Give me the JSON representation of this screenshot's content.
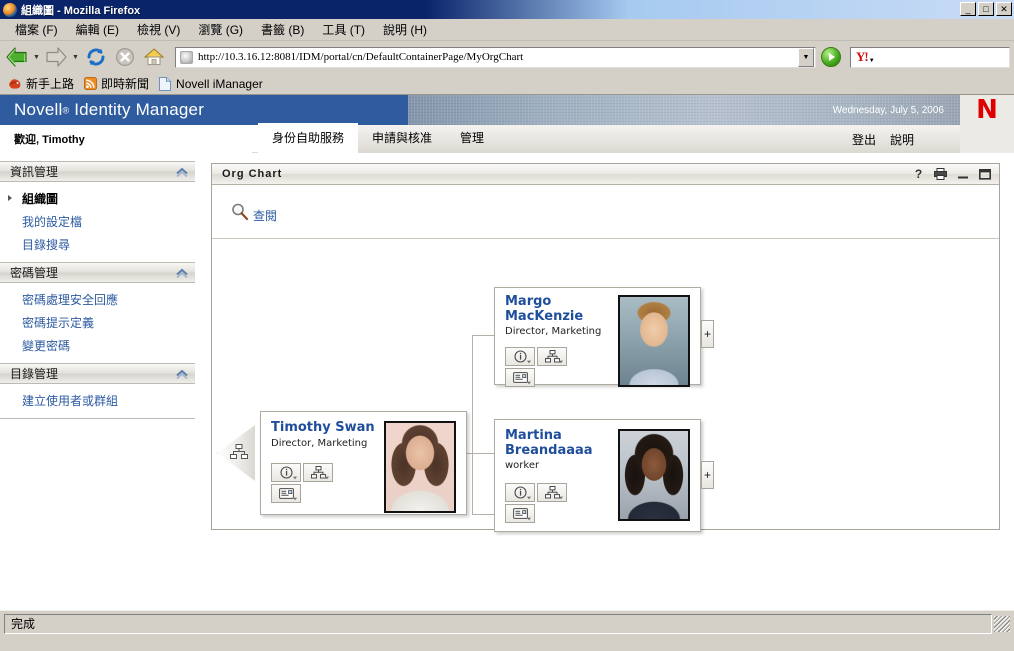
{
  "window": {
    "title": "組織圖 - Mozilla Firefox",
    "controls": {
      "minimize": "_",
      "maximize": "□",
      "close": "✕"
    }
  },
  "menubar": {
    "items": [
      {
        "label": "檔案 (F)"
      },
      {
        "label": "編輯 (E)"
      },
      {
        "label": "檢視 (V)"
      },
      {
        "label": "瀏覽 (G)"
      },
      {
        "label": "書籤 (B)"
      },
      {
        "label": "工具 (T)"
      },
      {
        "label": "說明 (H)"
      }
    ]
  },
  "navbar": {
    "url": "http://10.3.16.12:8081/IDM/portal/cn/DefaultContainerPage/MyOrgChart",
    "search_placeholder": "",
    "search_value": "",
    "yahoo_label": "Y!"
  },
  "bookmarks": {
    "items": [
      {
        "label": "新手上路",
        "icon": "firefox-bookmark-icon"
      },
      {
        "label": "即時新聞",
        "icon": "rss-feed-icon"
      },
      {
        "label": "Novell iManager",
        "icon": "page-icon"
      }
    ]
  },
  "banner": {
    "product": "Novell",
    "registered": "®",
    "product_suffix": "Identity Manager",
    "date": "Wednesday, July 5, 2006",
    "logo_letter": "N",
    "logo_color": "#e00000",
    "brand_blue": "#2f5c9e"
  },
  "tabrow": {
    "welcome": "歡迎, Timothy",
    "tabs": [
      {
        "label": "身份自助服務",
        "active": true
      },
      {
        "label": "申請與核准",
        "active": false
      },
      {
        "label": "管理",
        "active": false
      }
    ],
    "links": [
      {
        "label": "登出"
      },
      {
        "label": "說明"
      }
    ]
  },
  "sidebar": {
    "sections": [
      {
        "title": "資訊管理",
        "items": [
          {
            "label": "組織圖",
            "current": true
          },
          {
            "label": "我的設定檔",
            "current": false
          },
          {
            "label": "目錄搜尋",
            "current": false
          }
        ]
      },
      {
        "title": "密碼管理",
        "items": [
          {
            "label": "密碼處理安全回應",
            "current": false
          },
          {
            "label": "密碼提示定義",
            "current": false
          },
          {
            "label": "變更密碼",
            "current": false
          }
        ]
      },
      {
        "title": "目錄管理",
        "items": [
          {
            "label": "建立使用者或群組",
            "current": false
          }
        ]
      }
    ]
  },
  "portlet": {
    "title": "Org Chart",
    "icons": [
      {
        "name": "help-icon",
        "glyph": "?"
      },
      {
        "name": "print-icon",
        "glyph": ""
      },
      {
        "name": "minimize-icon",
        "glyph": ""
      },
      {
        "name": "maximize-icon",
        "glyph": ""
      }
    ],
    "toolbar": {
      "lookup_label": "查閱",
      "lookup_icon": "magnifier-icon"
    }
  },
  "orgchart": {
    "root_nav_icon": "org-chart-icon",
    "nodes": [
      {
        "id": "timothy",
        "name": "Timothy Swan",
        "title": "Director, Marketing",
        "portrait": "portrait-timothy-swan",
        "expandable": false,
        "buttons": [
          {
            "name": "info-button",
            "icon": "info-icon"
          },
          {
            "name": "org-chart-button",
            "icon": "org-chart-icon"
          },
          {
            "name": "email-button",
            "icon": "email-icon"
          }
        ]
      },
      {
        "id": "margo",
        "name": "Margo MacKenzie",
        "title": "Director, Marketing",
        "portrait": "portrait-margo-mackenzie",
        "expandable": true,
        "expand_label": "+",
        "buttons": [
          {
            "name": "info-button",
            "icon": "info-icon"
          },
          {
            "name": "org-chart-button",
            "icon": "org-chart-icon"
          },
          {
            "name": "email-button",
            "icon": "email-icon"
          }
        ]
      },
      {
        "id": "martina",
        "name": "Martina Breandaaaa",
        "name_line1": "Martina",
        "name_line2": "Breandaaaa",
        "title": "worker",
        "portrait": "portrait-martina-breandaaaa",
        "expandable": true,
        "expand_label": "+",
        "buttons": [
          {
            "name": "info-button",
            "icon": "info-icon"
          },
          {
            "name": "org-chart-button",
            "icon": "org-chart-icon"
          },
          {
            "name": "email-button",
            "icon": "email-icon"
          }
        ]
      }
    ]
  },
  "statusbar": {
    "text": "完成"
  }
}
